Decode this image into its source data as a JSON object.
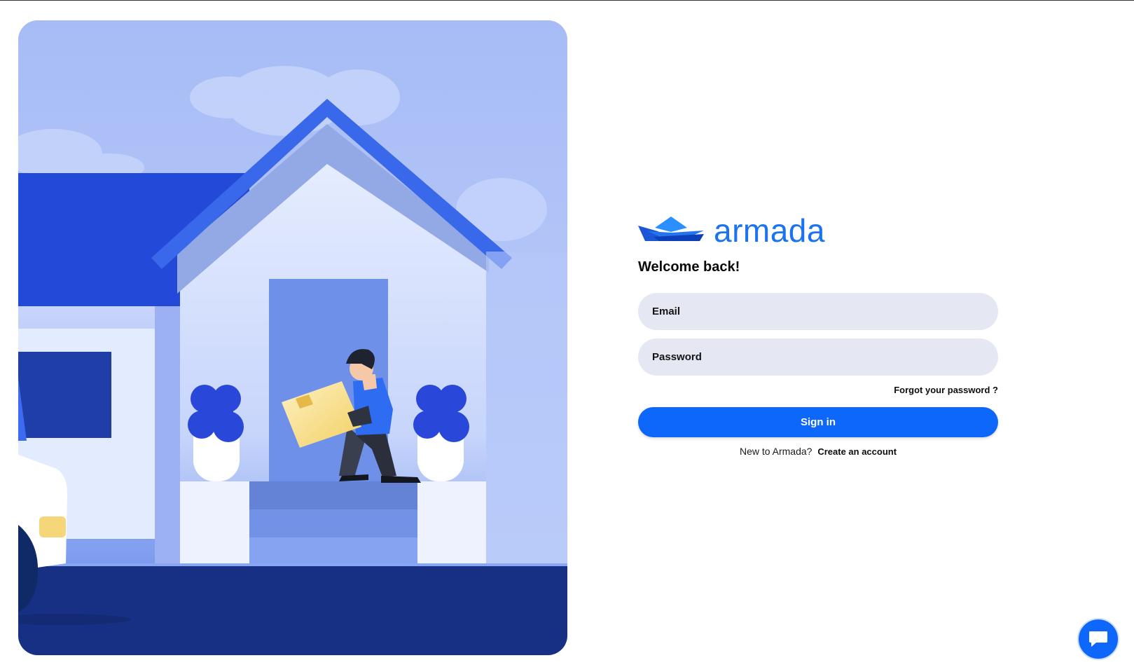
{
  "brand": {
    "name": "armada",
    "accent": "#1c73f0"
  },
  "hero": {
    "illustration": "delivery-man-with-package-at-house"
  },
  "login": {
    "heading": "Welcome back!",
    "email_placeholder": "Email",
    "password_placeholder": "Password",
    "forgot_label": "Forgot your password ?",
    "signin_label": "Sign in",
    "new_user_text": "New to Armada?",
    "create_account_label": "Create an account",
    "button_color": "#0d67fb"
  },
  "chat": {
    "icon": "chat-bubble-icon"
  }
}
